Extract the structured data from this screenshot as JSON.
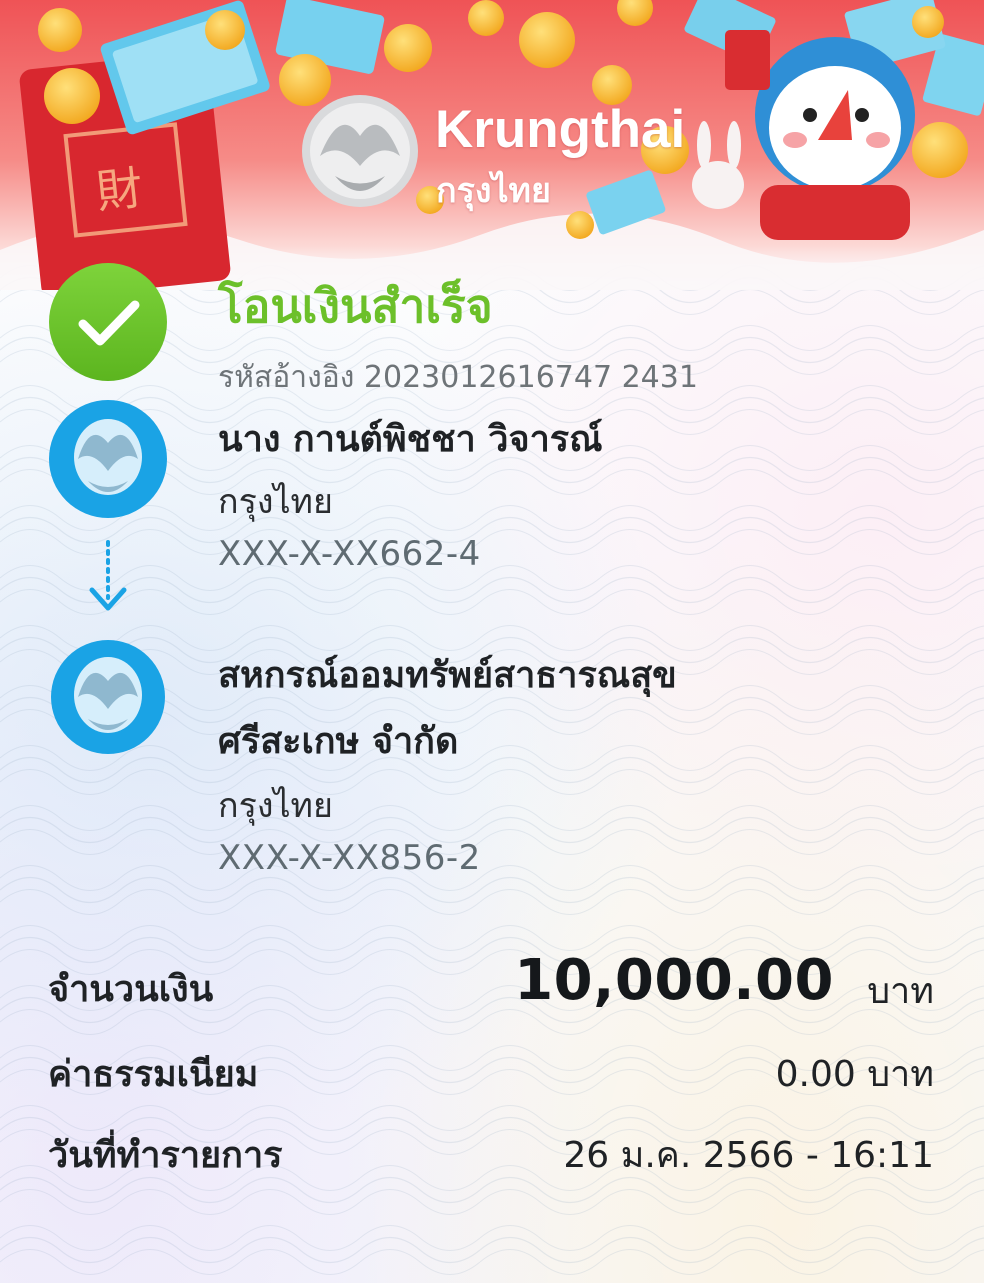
{
  "header": {
    "brand_en": "Krungthai",
    "brand_th": "กรุงไทย"
  },
  "status": {
    "title": "โอนเงินสำเร็จ",
    "reference": "รหัสอ้างอิง 2023012616747 2431"
  },
  "sender": {
    "name": "นาง กานต์พิชชา วิจารณ์",
    "bank": "กรุงไทย",
    "account": "XXX-X-XX662-4"
  },
  "receiver": {
    "name_line1": "สหกรณ์ออมทรัพย์สาธารณสุข",
    "name_line2": "ศรีสะเกษ จำกัด",
    "bank": "กรุงไทย",
    "account": "XXX-X-XX856-2"
  },
  "details": {
    "amount_label": "จำนวนเงิน",
    "amount_value": "10,000.00",
    "amount_unit": "บาท",
    "fee_label": "ค่าธรรมเนียม",
    "fee_value": "0.00 บาท",
    "date_label": "วันที่ทำรายการ",
    "date_value": "26 ม.ค. 2566 - 16:11"
  },
  "icons": {
    "status": "check-circle-icon",
    "bank_logo": "krungthai-bird-icon",
    "transfer": "arrow-down-dotted-icon"
  },
  "colors": {
    "success_green": "#6cc02a",
    "bank_blue": "#1aa3e5",
    "banner_red": "#e9474f"
  }
}
